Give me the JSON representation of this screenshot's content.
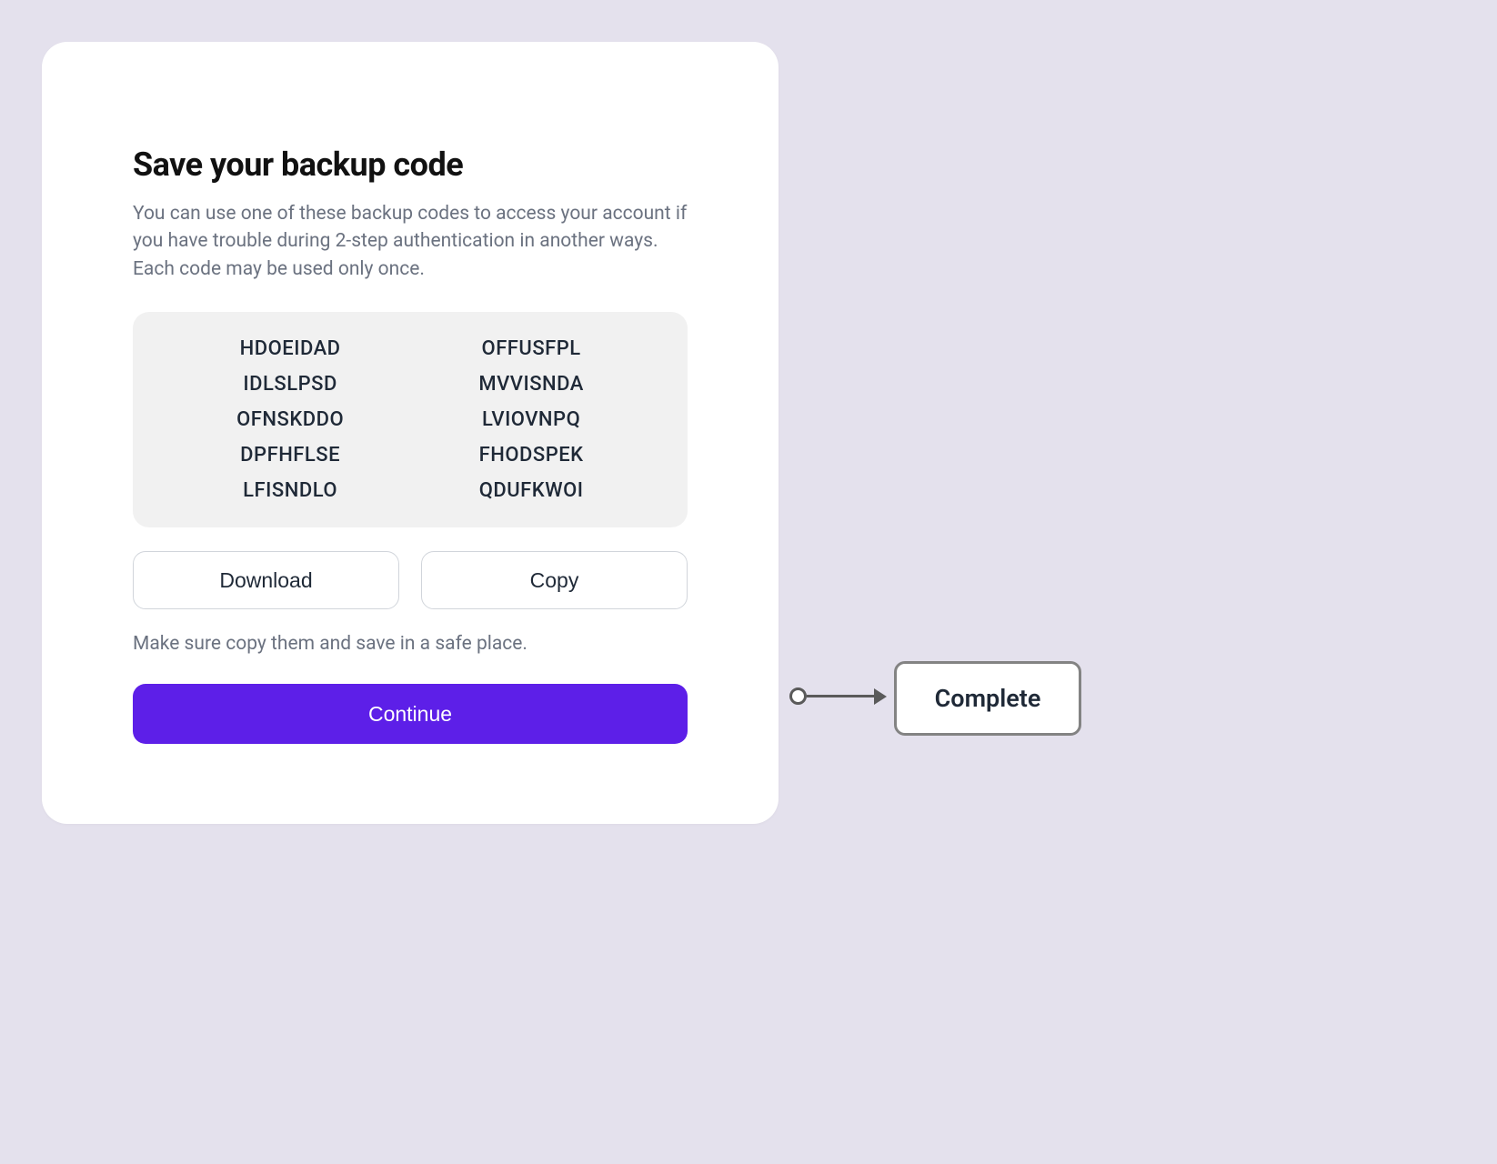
{
  "card": {
    "title": "Save your backup code",
    "description": "You can use one of these backup codes to access your account if you have trouble during 2-step authentication in another ways. Each code may be used only once.",
    "codes_left": [
      "HDOEIDAD",
      "IDLSLPSD",
      "OFNSKDDO",
      "DPFHFLSE",
      "LFISNDLO"
    ],
    "codes_right": [
      "OFFUSFPL",
      "MVVISNDA",
      "LVIOVNPQ",
      "FHODSPEK",
      "QDUFKWOI"
    ],
    "download_label": "Download",
    "copy_label": "Copy",
    "hint": "Make sure copy them and save in a safe place.",
    "continue_label": "Continue"
  },
  "flow": {
    "complete_label": "Complete"
  }
}
